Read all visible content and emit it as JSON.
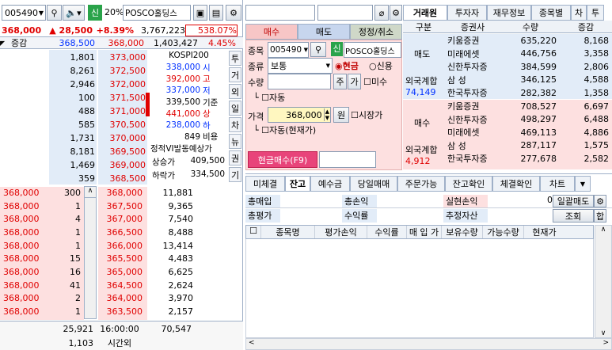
{
  "quote": {
    "code": "005490",
    "name": "POSCO홀딩스",
    "pct_toggle": "20%",
    "credit": "신",
    "price": "368,000",
    "change": "▲ 28,500",
    "rate": "+8.39%",
    "volume": "3,767,223",
    "vol_ratio": "538.07%",
    "diff_label": "증감",
    "ask_price": "368,500",
    "bid_price": "368,000",
    "prev_vol": "1,403,427",
    "turnover": "4.45%"
  },
  "ask_rows": [
    [
      "1,801",
      "373,000"
    ],
    [
      "8,261",
      "372,500"
    ],
    [
      "2,946",
      "372,000"
    ],
    [
      "100",
      "371,500"
    ],
    [
      "488",
      "371,000"
    ],
    [
      "585",
      "370,500"
    ],
    [
      "1,731",
      "370,000"
    ],
    [
      "8,181",
      "369,500"
    ],
    [
      "1,469",
      "369,000"
    ],
    [
      "359",
      "368,500"
    ]
  ],
  "bid_rows": [
    [
      "368,000",
      "300",
      "368,000",
      "11,881"
    ],
    [
      "368,000",
      "1",
      "367,500",
      "9,365"
    ],
    [
      "368,000",
      "4",
      "367,000",
      "7,540"
    ],
    [
      "368,000",
      "1",
      "366,500",
      "8,488"
    ],
    [
      "368,000",
      "1",
      "366,000",
      "13,414"
    ],
    [
      "368,000",
      "15",
      "365,500",
      "4,483"
    ],
    [
      "368,000",
      "16",
      "365,000",
      "6,625"
    ],
    [
      "368,000",
      "41",
      "364,500",
      "2,624"
    ],
    [
      "368,000",
      "2",
      "364,000",
      "3,970"
    ],
    [
      "368,000",
      "1",
      "363,500",
      "2,157"
    ]
  ],
  "info": {
    "index": "KOSPI200",
    "rows": [
      [
        "338,000",
        "시"
      ],
      [
        "392,000",
        "고"
      ],
      [
        "337,000",
        "저"
      ],
      [
        "339,500",
        "기준"
      ],
      [
        "441,000",
        "상"
      ],
      [
        "238,000",
        "하"
      ],
      [
        "849",
        "비용"
      ]
    ],
    "vi": "정적VI발동예상가",
    "up_label": "상승가",
    "up_val": "409,500",
    "down_label": "하락가",
    "down_val": "334,500"
  },
  "vtabs": [
    "투",
    "거",
    "외",
    "일",
    "차",
    "뉴",
    "권",
    "기"
  ],
  "footer": {
    "ask_total": "25,921",
    "time": "16:00:00",
    "bid_total": "70,547",
    "extra": "1,103",
    "after": "시간외"
  },
  "order": {
    "tabs": [
      "매수",
      "매도",
      "정정/취소"
    ],
    "code_label": "종목",
    "code": "005490",
    "credit": "신",
    "name": "POSCO홀딩스",
    "type_label": "종류",
    "type": "보통",
    "cash": "현금",
    "credit_radio": "신용",
    "qty_label": "수량",
    "qty_btn1": "주",
    "qty_btn2": "가",
    "misu": "미수",
    "auto": "자동",
    "price_label": "가격",
    "price": "368,000",
    "won": "원",
    "market": "시장가",
    "auto2": "자동(현재가)",
    "submit": "현금매수(F9)"
  },
  "broker": {
    "tabs": [
      "거래원",
      "투자자",
      "재무정보",
      "종목별",
      "차",
      "투"
    ],
    "headers": [
      "구분",
      "증권사",
      "수량",
      "증감"
    ],
    "sell_label": "매도",
    "sell": [
      [
        "키움증권",
        "635,220",
        "8,168"
      ],
      [
        "미래에셋",
        "446,756",
        "3,358"
      ],
      [
        "신한투자증",
        "384,599",
        "2,806"
      ],
      [
        "삼   성",
        "346,125",
        "4,588"
      ],
      [
        "한국투자증",
        "282,382",
        "1,358"
      ]
    ],
    "sell_foreign_label": "외국계합",
    "sell_foreign": "74,149",
    "buy_label": "매수",
    "buy": [
      [
        "키움증권",
        "708,527",
        "6,697"
      ],
      [
        "신한투자증",
        "498,297",
        "6,488"
      ],
      [
        "미래에셋",
        "469,113",
        "4,886"
      ],
      [
        "삼   성",
        "287,117",
        "1,575"
      ],
      [
        "한국투자증",
        "277,678",
        "2,582"
      ]
    ],
    "buy_foreign_label": "외국계합",
    "buy_foreign": "4,912"
  },
  "account": {
    "tabs": [
      "미체결",
      "잔고",
      "예수금",
      "당일매매",
      "주문가능",
      "잔고확인",
      "체결확인",
      "차트"
    ],
    "r1": [
      "총매입",
      "총손익",
      "실현손익",
      "0",
      "일괄매도"
    ],
    "r2": [
      "총평가",
      "수익률",
      "추정자산",
      "조회",
      "합"
    ],
    "cols": [
      "종목명",
      "평가손익",
      "수익률",
      "매 입 가",
      "보유수량",
      "가능수량",
      "현재가"
    ]
  }
}
